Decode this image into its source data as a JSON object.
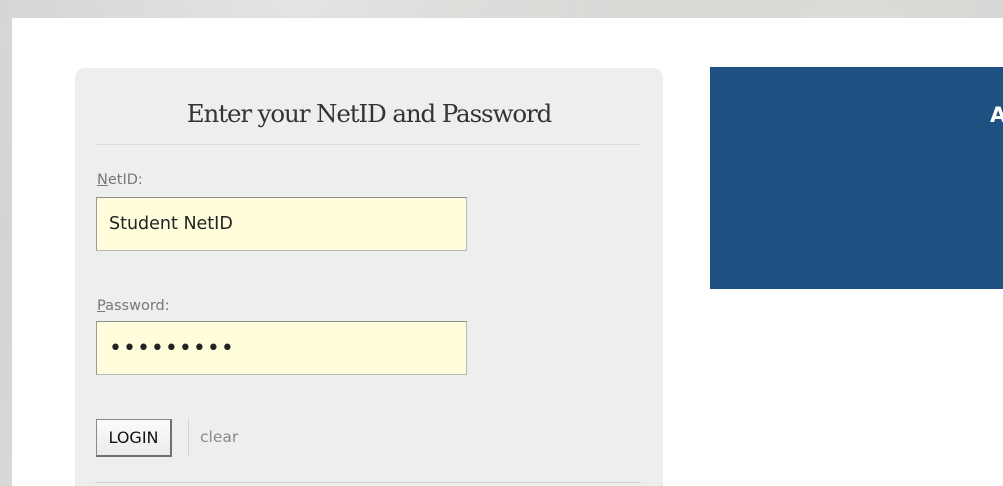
{
  "login": {
    "title": "Enter your NetID and Password",
    "netid_label_key": "N",
    "netid_label_rest": "etID:",
    "netid_value": "Student NetID",
    "password_label_key": "P",
    "password_label_rest": "assword:",
    "password_value": "passw0rd!",
    "login_button": "LOGIN",
    "clear_link": "clear"
  },
  "info_panel": {
    "heading_partial": "A",
    "background_color": "#1f5082"
  },
  "colors": {
    "input_background": "#fffddb",
    "login_box_background": "#eeeeee"
  }
}
